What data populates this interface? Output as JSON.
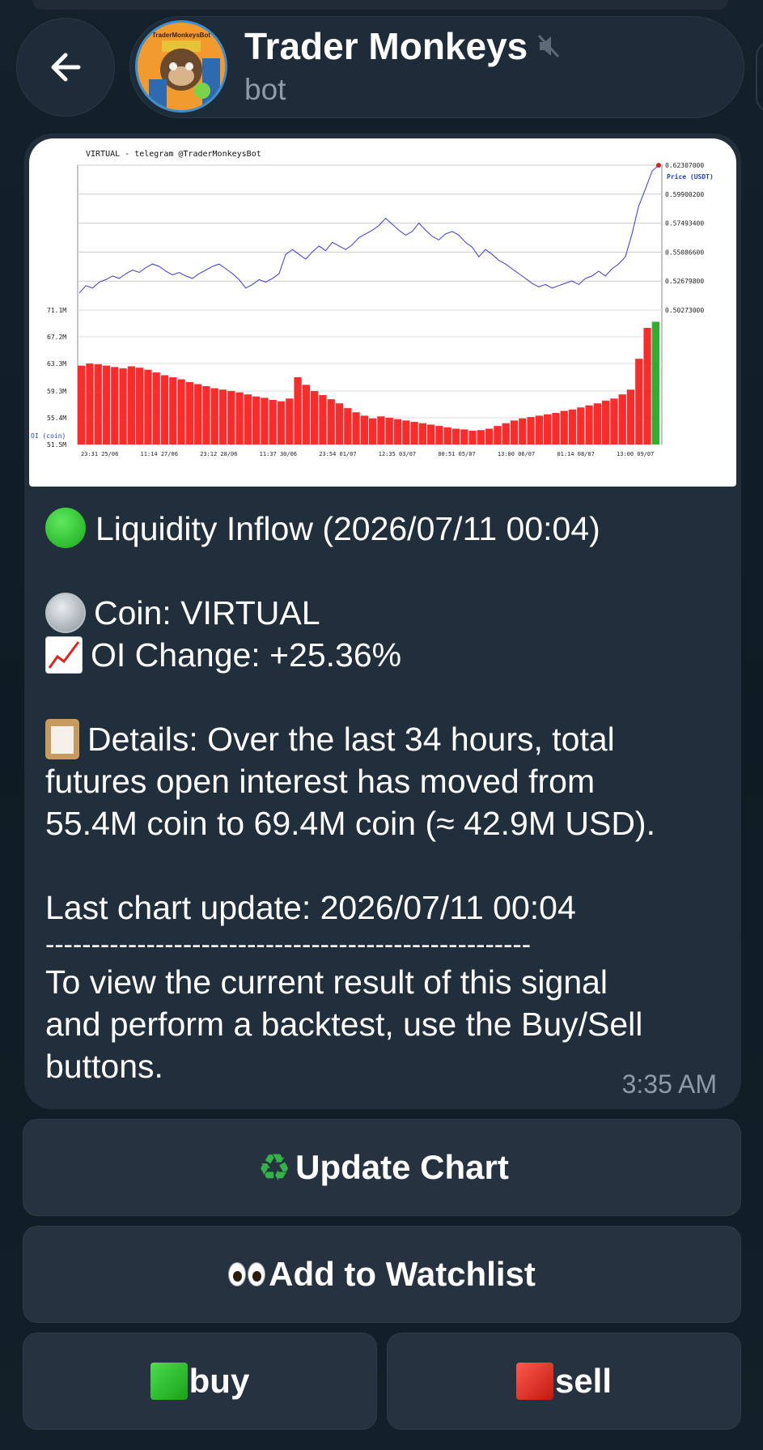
{
  "header": {
    "title": "Trader Monkeys",
    "subtitle": "bot",
    "muted_icon": "muted-speaker-icon",
    "back_icon": "arrow-left-icon",
    "avatar_caption": "TraderMonkeysBot"
  },
  "message": {
    "line1": "Liquidity Inflow (2026/07/11 00:04)",
    "coin": "Coin: VIRTUAL",
    "oi_change": "OI Change: +25.36%",
    "details_l1": "Details: Over the last 34 hours, total",
    "details_l2": "futures open interest has moved from",
    "details_l3": "55.4M coin to 69.4M coin (≈ 42.9M USD).",
    "last_update": "Last chart update: 2026/07/11 00:04",
    "divider": "-----------------------------------------------------",
    "cta_l1": "To view the current result of this signal",
    "cta_l2": "and perform a backtest, use the Buy/Sell",
    "cta_l3": "buttons.",
    "time": "3:35 AM"
  },
  "buttons": {
    "update_chart": "Update Chart",
    "add_watchlist": "Add to Watchlist",
    "buy": "buy",
    "sell": "sell"
  },
  "colors": {
    "background": "#0f1a22",
    "bubble": "#212f3c",
    "button": "#26323f",
    "price_line": "#3a3ad0",
    "oi_bars": "#ff2020",
    "accent_green": "#1aa81a"
  },
  "chart_data": {
    "type": "line",
    "title": "VIRTUAL - telegram @TraderMonkeysBot",
    "price_label": "Price (USDT)",
    "oi_label": "OI (coin)",
    "price_ticks": [
      "0.62307000",
      "0.59900200",
      "0.57493400",
      "0.55086600",
      "0.52679800",
      "0.50273000"
    ],
    "oi_ticks": [
      "71.1M",
      "67.2M",
      "63.3M",
      "59.3M",
      "55.4M",
      "51.5M"
    ],
    "x_ticks": [
      "23:31 25/06",
      "11:14 27/06",
      "23:12 28/06",
      "11:37 30/06",
      "23:54 01/07",
      "12:35 03/07",
      "00:51 05/07",
      "13:00 06/07",
      "01:14 08/07",
      "13:00 09/07"
    ],
    "price_ylim": [
      0.50273,
      0.62307
    ],
    "oi_ylim": [
      51.5,
      71.1
    ],
    "price_series": [
      0.517,
      0.523,
      0.521,
      0.526,
      0.528,
      0.531,
      0.529,
      0.533,
      0.536,
      0.534,
      0.538,
      0.541,
      0.539,
      0.535,
      0.532,
      0.534,
      0.531,
      0.529,
      0.533,
      0.536,
      0.539,
      0.541,
      0.537,
      0.533,
      0.528,
      0.521,
      0.524,
      0.528,
      0.526,
      0.529,
      0.533,
      0.549,
      0.553,
      0.549,
      0.545,
      0.551,
      0.556,
      0.552,
      0.559,
      0.556,
      0.553,
      0.557,
      0.563,
      0.566,
      0.569,
      0.573,
      0.579,
      0.574,
      0.569,
      0.565,
      0.568,
      0.575,
      0.569,
      0.564,
      0.561,
      0.566,
      0.568,
      0.565,
      0.559,
      0.555,
      0.547,
      0.553,
      0.549,
      0.544,
      0.541,
      0.537,
      0.533,
      0.529,
      0.525,
      0.522,
      0.524,
      0.521,
      0.523,
      0.525,
      0.527,
      0.524,
      0.529,
      0.531,
      0.535,
      0.531,
      0.537,
      0.541,
      0.547,
      0.566,
      0.589,
      0.603,
      0.618,
      0.623
    ],
    "oi_series": [
      63.0,
      63.3,
      63.2,
      63.0,
      62.8,
      62.6,
      62.9,
      62.7,
      62.4,
      62.0,
      61.6,
      61.3,
      61.0,
      60.6,
      60.3,
      60.0,
      59.7,
      59.5,
      59.3,
      59.1,
      58.8,
      58.5,
      58.3,
      58.0,
      57.8,
      58.2,
      61.3,
      60.2,
      59.3,
      58.7,
      58.1,
      57.5,
      56.8,
      56.2,
      55.7,
      55.3,
      55.6,
      55.4,
      55.2,
      55.0,
      54.8,
      54.6,
      54.4,
      54.2,
      54.0,
      53.8,
      53.7,
      53.5,
      53.6,
      53.8,
      54.2,
      54.6,
      55.0,
      55.3,
      55.5,
      55.7,
      55.9,
      56.1,
      56.4,
      56.6,
      56.9,
      57.2,
      57.5,
      57.9,
      58.2,
      58.8,
      59.5,
      64.0,
      68.5,
      69.4
    ]
  }
}
